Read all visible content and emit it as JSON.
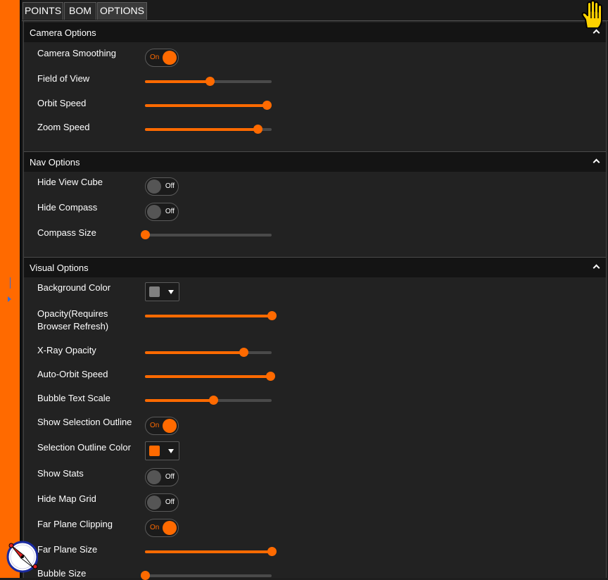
{
  "tabs": [
    {
      "label": "POINTS"
    },
    {
      "label": "BOM"
    },
    {
      "label": "OPTIONS",
      "active": true
    }
  ],
  "sections": {
    "camera": {
      "title": "Camera Options",
      "camera_smoothing": {
        "label": "Camera Smoothing",
        "state": "On"
      },
      "field_of_view": {
        "label": "Field of View",
        "value": 0.51
      },
      "orbit_speed": {
        "label": "Orbit Speed",
        "value": 0.96
      },
      "zoom_speed": {
        "label": "Zoom Speed",
        "value": 0.89
      }
    },
    "nav": {
      "title": "Nav Options",
      "hide_view_cube": {
        "label": "Hide View Cube",
        "state": "Off"
      },
      "hide_compass": {
        "label": "Hide Compass",
        "state": "Off"
      },
      "compass_size": {
        "label": "Compass Size",
        "value": 0.0
      }
    },
    "visual": {
      "title": "Visual Options",
      "background_color": {
        "label": "Background Color",
        "color": "#808080"
      },
      "opacity": {
        "label_line1": "Opacity(Requires",
        "label_line2": "Browser Refresh)",
        "value": 1.0
      },
      "xray_opacity": {
        "label": "X-Ray Opacity",
        "value": 0.78
      },
      "auto_orbit_speed": {
        "label": "Auto-Orbit Speed",
        "value": 0.99
      },
      "bubble_text_scale": {
        "label": "Bubble Text Scale",
        "value": 0.54
      },
      "show_selection_outline": {
        "label": "Show Selection Outline",
        "state": "On"
      },
      "selection_outline_color": {
        "label": "Selection Outline Color",
        "color": "#ff6a00"
      },
      "show_stats": {
        "label": "Show Stats",
        "state": "Off"
      },
      "hide_map_grid": {
        "label": "Hide Map Grid",
        "state": "Off"
      },
      "far_plane_clipping": {
        "label": "Far Plane Clipping",
        "state": "On"
      },
      "far_plane_size": {
        "label": "Far Plane Size",
        "value": 1.0
      },
      "bubble_size": {
        "label": "Bubble Size",
        "value": 0.0
      }
    }
  },
  "colors": {
    "accent": "#ff6a00",
    "panel_bg": "#222222",
    "header_bg": "#141414"
  },
  "icons": {
    "section_toggle": "chevron-up-icon",
    "cursor": "hand-pointer-icon",
    "compass": "compass-icon"
  }
}
